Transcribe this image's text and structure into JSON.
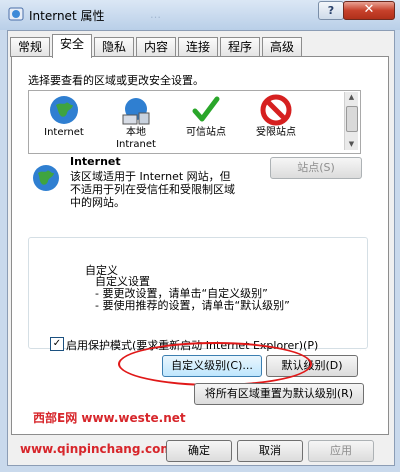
{
  "window": {
    "title": "Internet 属性",
    "ghost_title": "…",
    "help": "?",
    "close": "✕"
  },
  "tabs": [
    "常规",
    "安全",
    "隐私",
    "内容",
    "连接",
    "程序",
    "高级"
  ],
  "security": {
    "prompt": "选择要查看的区域或更改安全设置。",
    "zones": [
      {
        "label": "Internet",
        "icon": "globe-icon"
      },
      {
        "label": "本地\nIntranet",
        "icon": "intranet-icon"
      },
      {
        "label": "可信站点",
        "icon": "checkmark-icon"
      },
      {
        "label": "受限站点",
        "icon": "no-entry-icon"
      }
    ],
    "zone_name": "Internet",
    "zone_desc": "该区域适用于 Internet 网站，但\n不适用于列在受信任和受限制区域\n中的网站。",
    "sites_button": "站点(S)",
    "custom_title": "自定义",
    "custom_desc": "自定义设置\n- 要更改设置，请单击“自定义级别”\n- 要使用推荐的设置，请单击“默认级别”",
    "protected_mode": "启用保护模式(要求重新启动 Internet Explorer)(P)",
    "protected_checked": "✓",
    "custom_level_button": "自定义级别(C)...",
    "default_level_button": "默认级别(D)",
    "reset_all_button": "将所有区域重置为默认级别(R)"
  },
  "footer": {
    "ok_button": "确定",
    "cancel_button": "取消",
    "apply_button": "应用"
  },
  "watermarks": [
    "西部E网 www.weste.net",
    "www.qinpinchang.com"
  ],
  "colors": {
    "accent_red": "#e01818",
    "watermark": "#d7262b"
  }
}
